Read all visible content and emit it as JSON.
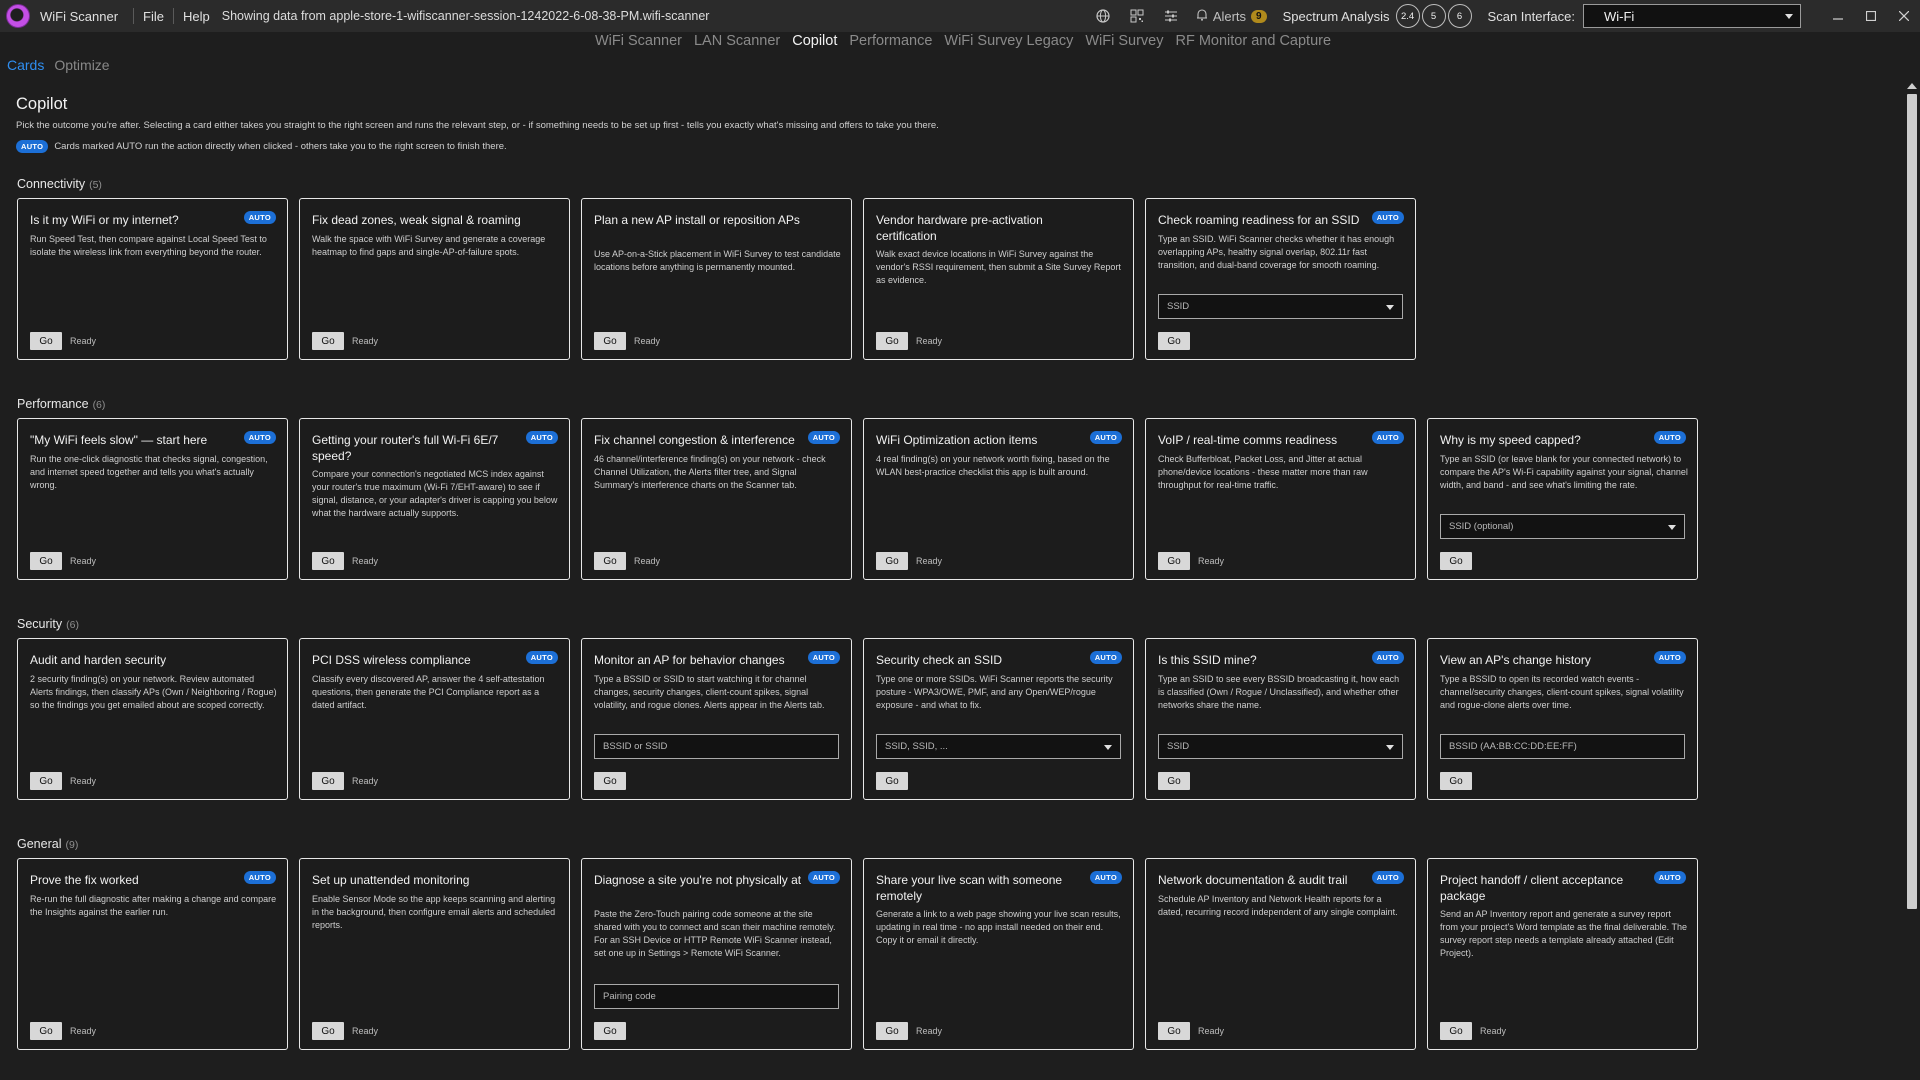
{
  "titlebar": {
    "app_name": "WiFi Scanner",
    "menu": [
      "File",
      "Help"
    ],
    "file_info": "Showing data from apple-store-1-wifiscanner-session-1242022-6-08-38-PM.wifi-scanner",
    "alerts_label": "Alerts",
    "alerts_count": "9",
    "spectrum_label": "Spectrum Analysis",
    "bands": [
      "2.4",
      "5",
      "6"
    ],
    "scan_interface_label": "Scan Interface:",
    "scan_interface_value": "Wi-Fi"
  },
  "main_tabs": [
    "WiFi Scanner",
    "LAN Scanner",
    "Copilot",
    "Performance",
    "WiFi Survey Legacy",
    "WiFi Survey",
    "RF Monitor and Capture"
  ],
  "active_main_tab": "Copilot",
  "sub_tabs": [
    "Cards",
    "Optimize"
  ],
  "page": {
    "title": "Copilot",
    "description": "Pick the outcome you're after. Selecting a card either takes you straight to the right screen and runs the relevant step, or - if something needs to be set up first - tells you exactly what's missing and offers to take you there.",
    "auto_badge": "AUTO",
    "auto_note": "Cards marked AUTO run the action directly when clicked - others take you to the right screen to finish there."
  },
  "common": {
    "go": "Go",
    "ready": "Ready",
    "auto": "AUTO"
  },
  "sections": [
    {
      "title": "Connectivity",
      "count": "(5)",
      "cards": [
        {
          "title": "Is it my WiFi or my internet?",
          "auto": true,
          "desc": "Run Speed Test, then compare against Local Speed Test to isolate the wireless link from everything beyond the router.",
          "ready": true
        },
        {
          "title": "Fix dead zones, weak signal & roaming",
          "auto": false,
          "desc": "Walk the space with WiFi Survey and generate a coverage heatmap to find gaps and single-AP-of-failure spots.",
          "ready": true
        },
        {
          "title": "Plan a new AP install or reposition APs",
          "auto": false,
          "desc": "Use AP-on-a-Stick placement in WiFi Survey to test candidate locations before anything is permanently mounted.",
          "ready": true
        },
        {
          "title": "Vendor hardware pre-activation certification",
          "auto": false,
          "desc": "Walk exact device locations in WiFi Survey against the vendor's RSSI requirement, then submit a Site Survey Report as evidence.",
          "ready": true
        },
        {
          "title": "Check roaming readiness for an SSID",
          "auto": true,
          "desc": "Type an SSID. WiFi Scanner checks whether it has enough overlapping APs, healthy signal overlap, 802.11r fast transition, and dual-band coverage for smooth roaming.",
          "input": "SSID",
          "dropdown": true,
          "ready": false
        }
      ]
    },
    {
      "title": "Performance",
      "count": "(6)",
      "cards": [
        {
          "title": "\"My WiFi feels slow\" — start here",
          "auto": true,
          "desc": "Run the one-click diagnostic that checks signal, congestion, and internet speed together and tells you what's actually wrong.",
          "ready": true
        },
        {
          "title": "Getting your router's full Wi-Fi 6E/7 speed?",
          "auto": true,
          "desc": "Compare your connection's negotiated MCS index against your router's true maximum (Wi-Fi 7/EHT-aware) to see if signal, distance, or your adapter's driver is capping you below what the hardware actually supports.",
          "ready": true
        },
        {
          "title": "Fix channel congestion & interference",
          "auto": true,
          "desc": "46 channel/interference finding(s) on your network - check Channel Utilization, the Alerts filter tree, and Signal Summary's interference charts on the Scanner tab.",
          "ready": true
        },
        {
          "title": "WiFi Optimization action items",
          "auto": true,
          "desc": "4 real finding(s) on your network worth fixing, based on the WLAN best-practice checklist this app is built around.",
          "ready": true
        },
        {
          "title": "VoIP / real-time comms readiness",
          "auto": true,
          "desc": "Check Bufferbloat, Packet Loss, and Jitter at actual phone/device locations - these matter more than raw throughput for real-time traffic.",
          "ready": true
        },
        {
          "title": "Why is my speed capped?",
          "auto": true,
          "desc": "Type an SSID (or leave blank for your connected network) to compare the AP's Wi-Fi capability against your signal, channel width, and band - and see what's limiting the rate.",
          "input": "SSID (optional)",
          "dropdown": true,
          "ready": false
        }
      ]
    },
    {
      "title": "Security",
      "count": "(6)",
      "cards": [
        {
          "title": "Audit and harden security",
          "auto": false,
          "desc": "2 security finding(s) on your network. Review automated Alerts findings, then classify APs (Own / Neighboring / Rogue) so the findings you get emailed about are scoped correctly.",
          "ready": true
        },
        {
          "title": "PCI DSS wireless compliance",
          "auto": true,
          "desc": "Classify every discovered AP, answer the 4 self-attestation questions, then generate the PCI Compliance report as a dated artifact.",
          "ready": true
        },
        {
          "title": "Monitor an AP for behavior changes",
          "auto": true,
          "desc": "Type a BSSID or SSID to start watching it for channel changes, security changes, client-count spikes, signal volatility, and rogue clones. Alerts appear in the Alerts tab.",
          "input": "BSSID or SSID",
          "dropdown": false,
          "ready": false
        },
        {
          "title": "Security check an SSID",
          "auto": true,
          "desc": "Type one or more SSIDs. WiFi Scanner reports the security posture - WPA3/OWE, PMF, and any Open/WEP/rogue exposure - and what to fix.",
          "input": "SSID, SSID, ...",
          "dropdown": true,
          "ready": false
        },
        {
          "title": "Is this SSID mine?",
          "auto": true,
          "desc": "Type an SSID to see every BSSID broadcasting it, how each is classified (Own / Rogue / Unclassified), and whether other networks share the name.",
          "input": "SSID",
          "dropdown": true,
          "ready": false
        },
        {
          "title": "View an AP's change history",
          "auto": true,
          "desc": "Type a BSSID to open its recorded watch events - channel/security changes, client-count spikes, signal volatility and rogue-clone alerts over time.",
          "input": "BSSID (AA:BB:CC:DD:EE:FF)",
          "dropdown": false,
          "ready": false
        }
      ]
    },
    {
      "title": "General",
      "count": "(9)",
      "cards": [
        {
          "title": "Prove the fix worked",
          "auto": true,
          "desc": "Re-run the full diagnostic after making a change and compare the Insights against the earlier run.",
          "ready": true
        },
        {
          "title": "Set up unattended monitoring",
          "auto": false,
          "desc": "Enable Sensor Mode so the app keeps scanning and alerting in the background, then configure email alerts and scheduled reports.",
          "ready": true
        },
        {
          "title": "Diagnose a site you're not physically at",
          "auto": true,
          "desc": "Paste the Zero-Touch pairing code someone at the site shared with you to connect and scan their machine remotely. For an SSH Device or HTTP Remote WiFi Scanner instead, set one up in Settings > Remote WiFi Scanner.",
          "input": "Pairing code",
          "dropdown": false,
          "ready": false
        },
        {
          "title": "Share your live scan with someone remotely",
          "auto": true,
          "desc": "Generate a link to a web page showing your live scan results, updating in real time - no app install needed on their end. Copy it or email it directly.",
          "ready": true
        },
        {
          "title": "Network documentation & audit trail",
          "auto": true,
          "desc": "Schedule AP Inventory and Network Health reports for a dated, recurring record independent of any single complaint.",
          "ready": true
        },
        {
          "title": "Project handoff / client acceptance package",
          "auto": true,
          "desc": "Send an AP Inventory report and generate a survey report from your project's Word template as the final deliverable. The survey report step needs a template already attached (Edit Project).",
          "ready": true
        }
      ]
    }
  ]
}
